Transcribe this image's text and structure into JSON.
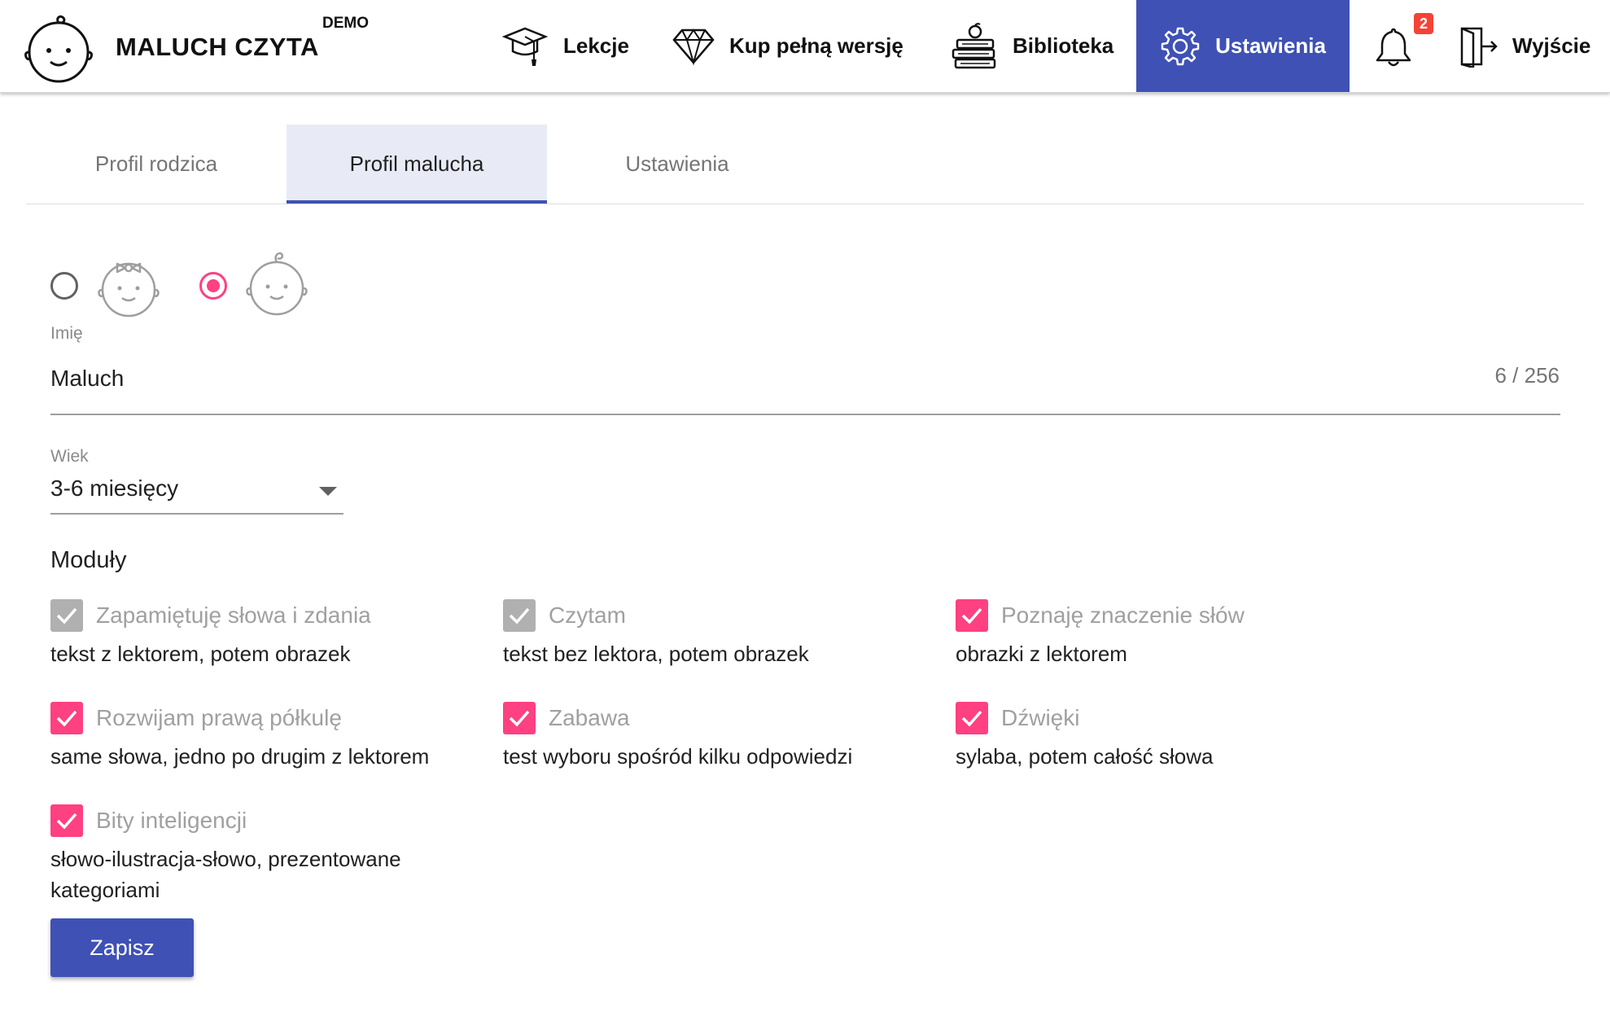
{
  "header": {
    "app_title": "MALUCH CZYTA",
    "demo_badge": "DEMO",
    "logo_icon": "baby-face-icon",
    "nav": [
      {
        "label": "Lekcje",
        "icon": "graduation-cap-icon"
      },
      {
        "label": "Kup pełną wersję",
        "icon": "diamond-icon"
      },
      {
        "label": "Biblioteka",
        "icon": "books-icon"
      },
      {
        "label": "Ustawienia",
        "icon": "gear-icon",
        "active": true
      }
    ],
    "notifications_count": "2",
    "exit_label": "Wyjście"
  },
  "tabs": [
    {
      "label": "Profil rodzica",
      "active": false
    },
    {
      "label": "Profil malucha",
      "active": true
    },
    {
      "label": "Ustawienia",
      "active": false
    }
  ],
  "gender": {
    "options": [
      {
        "icon": "baby-girl-icon",
        "selected": false
      },
      {
        "icon": "baby-boy-icon",
        "selected": true
      }
    ]
  },
  "name_field": {
    "label": "Imię",
    "value": "Maluch",
    "counter": "6 / 256"
  },
  "age_field": {
    "label": "Wiek",
    "value": "3-6 miesięcy"
  },
  "modules": {
    "title": "Moduły",
    "items": [
      {
        "title": "Zapamiętuję słowa i zdania",
        "desc": "tekst z lektorem, potem obrazek",
        "state": "disabled-checked"
      },
      {
        "title": "Czytam",
        "desc": "tekst bez lektora, potem obrazek",
        "state": "disabled-checked"
      },
      {
        "title": "Poznaję znaczenie słów",
        "desc": "obrazki z lektorem",
        "state": "checked"
      },
      {
        "title": "Rozwijam prawą półkulę",
        "desc": "same słowa, jedno po drugim z lektorem",
        "state": "checked"
      },
      {
        "title": "Zabawa",
        "desc": "test wyboru spośród kilku odpowiedzi",
        "state": "checked"
      },
      {
        "title": "Dźwięki",
        "desc": "sylaba, potem całość słowa",
        "state": "checked"
      },
      {
        "title": "Bity inteligencji",
        "desc": "słowo-ilustracja-słowo, prezentowane kategoriami",
        "state": "checked"
      }
    ]
  },
  "save_label": "Zapisz",
  "colors": {
    "primary": "#3f51b5",
    "accent": "#ff4081",
    "badge": "#f44336",
    "disabled_checkbox": "#b0b0b0"
  }
}
